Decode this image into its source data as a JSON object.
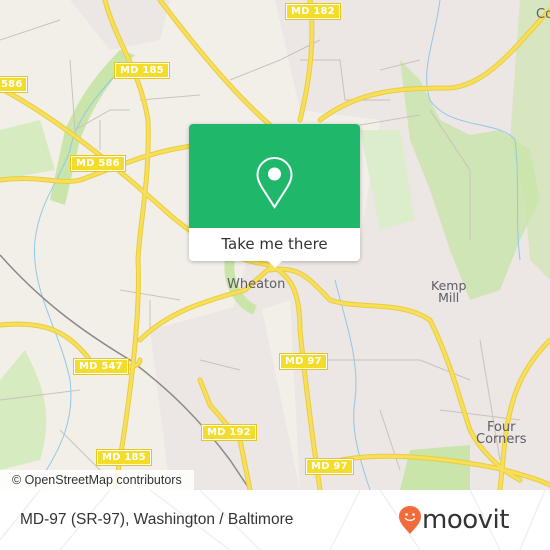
{
  "map": {
    "road_shields": [
      {
        "id": "md-182",
        "label": "MD 182"
      },
      {
        "id": "md-185-north",
        "label": "MD 185"
      },
      {
        "id": "md-586-west",
        "label": "586"
      },
      {
        "id": "md-586",
        "label": "MD 586"
      },
      {
        "id": "md-547",
        "label": "MD 547"
      },
      {
        "id": "md-97-mid",
        "label": "MD 97"
      },
      {
        "id": "md-192",
        "label": "MD 192"
      },
      {
        "id": "md-185-south",
        "label": "MD 185"
      },
      {
        "id": "md-97-south",
        "label": "MD 97"
      }
    ],
    "places": [
      {
        "id": "wheaton",
        "label": "Wheaton"
      },
      {
        "id": "kemp-mill",
        "label": "Kemp\nMill"
      },
      {
        "id": "four-corners",
        "label": "Four\nCorners"
      },
      {
        "id": "edge-label",
        "label": "Co"
      }
    ],
    "colors": {
      "land": "#f2efe9",
      "residential": "#ece6e4",
      "park": "#c9e5a9",
      "road": "#f7df5c",
      "water": "#8fc9e8"
    }
  },
  "popup": {
    "button_label": "Take me there",
    "accent_color": "#1fb86a"
  },
  "attribution": "© OpenStreetMap contributors",
  "footer": {
    "title": "MD-97 (SR-97), Washington / Baltimore",
    "brand": "moovit",
    "brand_color": "#f26b3a"
  }
}
